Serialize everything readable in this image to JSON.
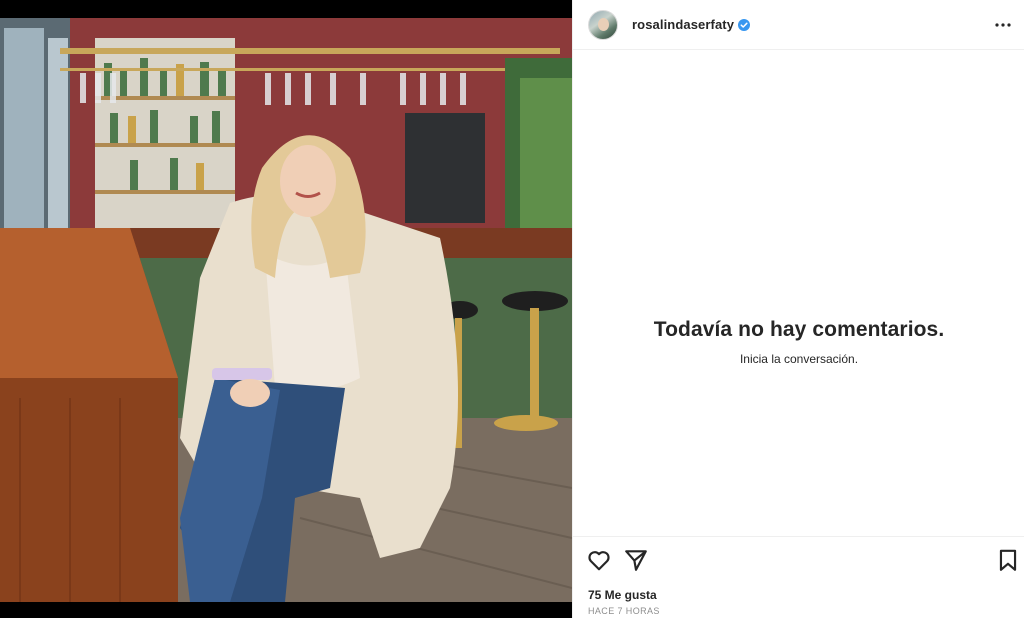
{
  "post": {
    "username": "rosalindaserfaty",
    "verified": true,
    "empty_state_title": "Todavía no hay comentarios.",
    "empty_state_subtitle": "Inicia la conversación.",
    "likes_text": "75 Me gusta",
    "timestamp": "HACE 7 HORAS"
  },
  "icons": {
    "more": "more-options-icon",
    "verified": "verified-badge-icon",
    "like": "heart-icon",
    "share": "paper-plane-icon",
    "save": "bookmark-icon"
  },
  "colors": {
    "verified_blue": "#3897f0",
    "text": "#262626",
    "muted": "#8e8e8e",
    "divider": "#efefef"
  }
}
